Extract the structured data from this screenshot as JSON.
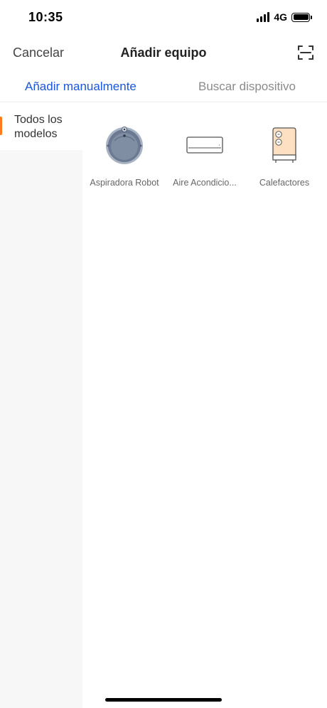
{
  "status_bar": {
    "time": "10:35",
    "network": "4G"
  },
  "nav": {
    "cancel": "Cancelar",
    "title": "Añadir equipo",
    "scan_icon": "scan-icon"
  },
  "tabs": [
    {
      "label": "Añadir manualmente",
      "active": true
    },
    {
      "label": "Buscar dispositivo",
      "active": false
    }
  ],
  "sidebar": {
    "items": [
      {
        "label": "Todos los modelos",
        "selected": true
      }
    ]
  },
  "devices": [
    {
      "label": "Aspiradora Robot",
      "icon": "robot-vacuum-icon"
    },
    {
      "label": "Aire Acondicio...",
      "icon": "air-conditioner-icon"
    },
    {
      "label": "Calefactores",
      "icon": "heater-icon"
    }
  ],
  "colors": {
    "accent_blue": "#1a56db",
    "indicator_orange": "#ff7a1a",
    "heater_fill": "#fde0c2"
  }
}
